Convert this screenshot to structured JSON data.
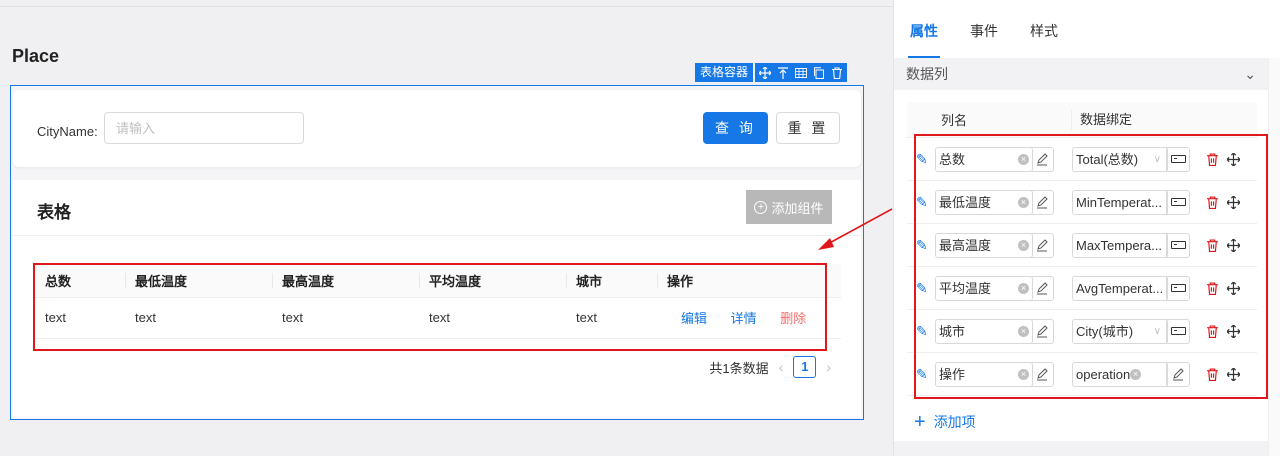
{
  "page": {
    "title": "Place"
  },
  "toolbar": {
    "tag": "表格容器"
  },
  "search": {
    "label": "CityName:",
    "placeholder": "请输入",
    "query_label": "查 询",
    "reset_label": "重 置"
  },
  "table_card": {
    "title": "表格",
    "add_component": "添加组件",
    "headers": [
      "总数",
      "最低温度",
      "最高温度",
      "平均温度",
      "城市",
      "操作"
    ],
    "row": [
      "text",
      "text",
      "text",
      "text",
      "text"
    ],
    "actions": {
      "edit": "编辑",
      "detail": "详情",
      "delete": "删除"
    },
    "pagination": {
      "total_text": "共1条数据",
      "current_page": "1"
    }
  },
  "panel": {
    "tabs": [
      "属性",
      "事件",
      "样式"
    ],
    "section": "数据列",
    "col_headers": {
      "name": "列名",
      "binding": "数据绑定"
    },
    "rows": [
      {
        "name": "总数",
        "binding": "Total(总数)"
      },
      {
        "name": "最低温度",
        "binding": "MinTemperat..."
      },
      {
        "name": "最高温度",
        "binding": "MaxTempera..."
      },
      {
        "name": "平均温度",
        "binding": "AvgTemperat..."
      },
      {
        "name": "城市",
        "binding": "City(城市)"
      },
      {
        "name": "操作",
        "binding": "operation"
      }
    ],
    "add_item": "添加项"
  },
  "colors": {
    "primary": "#1677e6",
    "danger": "#f56c6c",
    "annotation": "#e0181c"
  }
}
